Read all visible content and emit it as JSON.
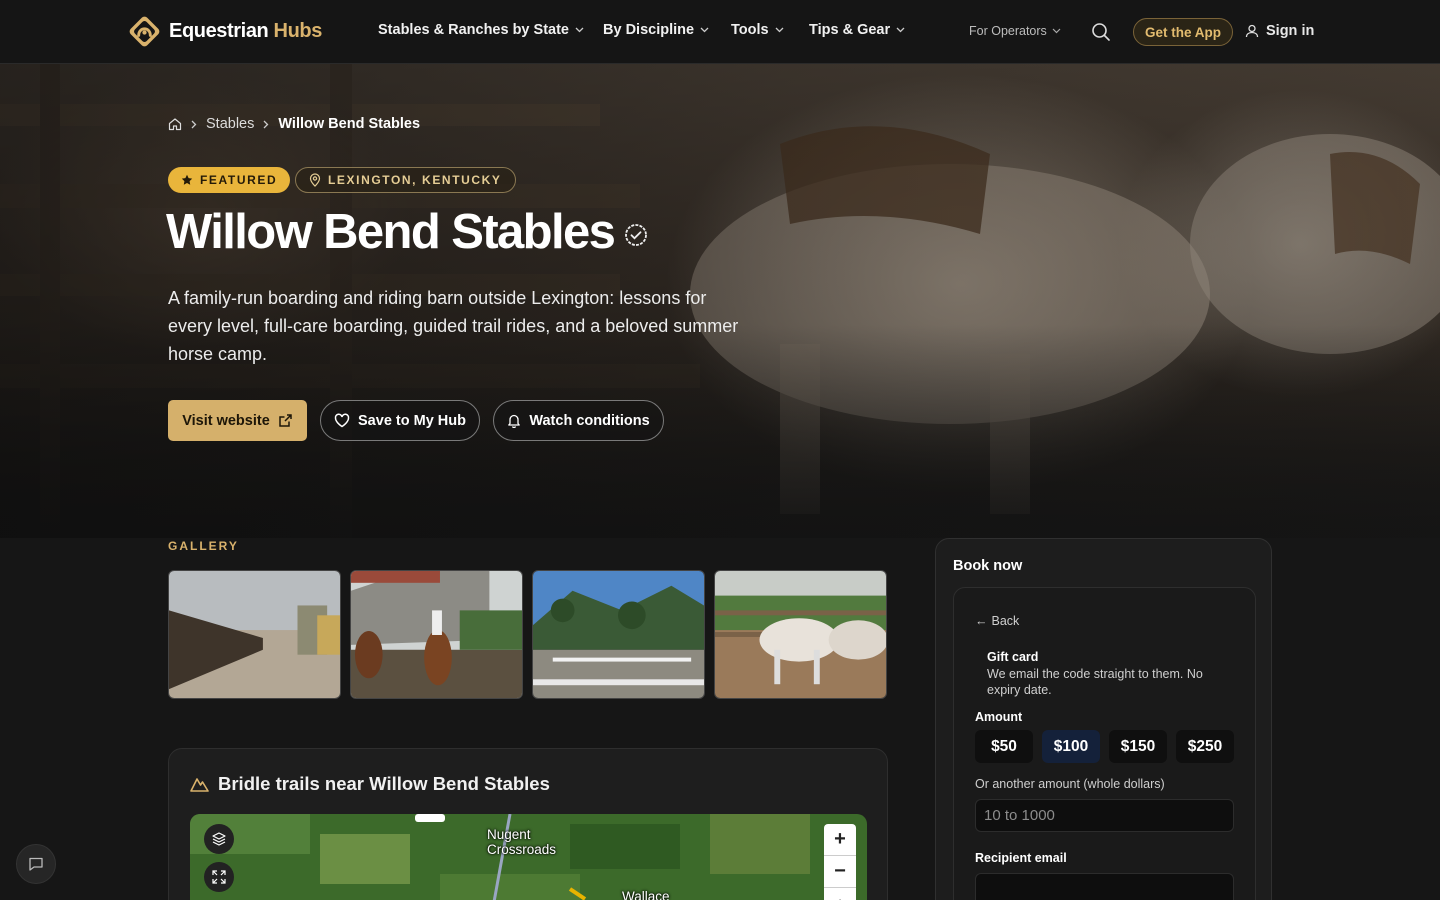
{
  "nav": {
    "logo_main": "Equestrian",
    "logo_accent": "Hubs",
    "items": [
      {
        "label": "Stables & Ranches by State"
      },
      {
        "label": "By Discipline"
      },
      {
        "label": "Tools"
      },
      {
        "label": "Tips & Gear"
      }
    ],
    "operators": "For Operators",
    "get_app": "Get the App",
    "sign_in": "Sign in"
  },
  "breadcrumb": {
    "section": "Stables",
    "current": "Willow Bend Stables"
  },
  "hero": {
    "featured": "FEATURED",
    "location": "LEXINGTON, KENTUCKY",
    "title": "Willow Bend Stables",
    "description": "A family-run boarding and riding barn outside Lexington: lessons for every level, full-care boarding, guided trail rides, and a beloved summer horse camp.",
    "visit": "Visit website",
    "save": "Save to My Hub",
    "watch": "Watch conditions"
  },
  "gallery": {
    "label": "GALLERY"
  },
  "trails": {
    "title": "Bridle trails near Willow Bend Stables",
    "map_labels": [
      "Nugent Crossroads",
      "Wallace"
    ]
  },
  "booking": {
    "title": "Book now",
    "back": "Back",
    "gift_title": "Gift card",
    "gift_sub": "We email the code straight to them. No expiry date.",
    "amount_label": "Amount",
    "amounts": [
      "$50",
      "$100",
      "$150",
      "$250"
    ],
    "selected_amount": "$100",
    "other_label": "Or another amount (whole dollars)",
    "other_placeholder": "10 to 1000",
    "recipient_label": "Recipient email"
  },
  "colors": {
    "accent": "#d9b26c",
    "featured": "#e9b53b",
    "background": "#161616"
  }
}
